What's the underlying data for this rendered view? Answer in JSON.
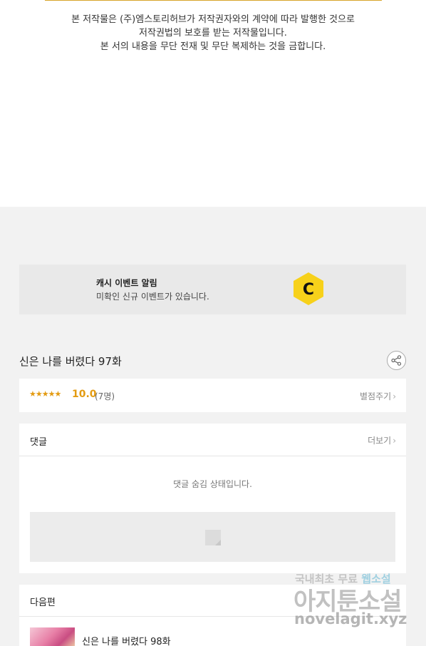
{
  "copyright": {
    "line1": "본 저작물은 (주)엠스토리허브가 저작권자와의 계약에 따라 발행한 것으로",
    "line2": "저작권법의 보호를 받는 저작물입니다.",
    "line3": "본 서의 내용을 무단 전재 및 무단 복제하는 것을 금합니다."
  },
  "cash_banner": {
    "title": "캐시 이벤트 알림",
    "subtitle": "미확인 신규 이벤트가 있습니다.",
    "logo_letter": "C",
    "logo_color": "#f7d11a"
  },
  "episode": {
    "title": "신은 나를 버렸다 97화",
    "share_icon": "share-icon"
  },
  "rating": {
    "stars": "★★★★★",
    "value": "10.0",
    "count": "(7명)",
    "rate_label": "별점주기",
    "accent_color": "#e39b12"
  },
  "comments": {
    "title": "댓글",
    "more_label": "더보기",
    "hidden_message": "댓글 숨김 상태입니다."
  },
  "next": {
    "header": "다음편",
    "episode_title": "신은 나를 버렸다 98화"
  },
  "watermark": {
    "top_left": "국내최초 무료",
    "top_right": "웹소설",
    "main": "아지툰소설",
    "url": "novelagit.xyz"
  },
  "chevron": "›"
}
